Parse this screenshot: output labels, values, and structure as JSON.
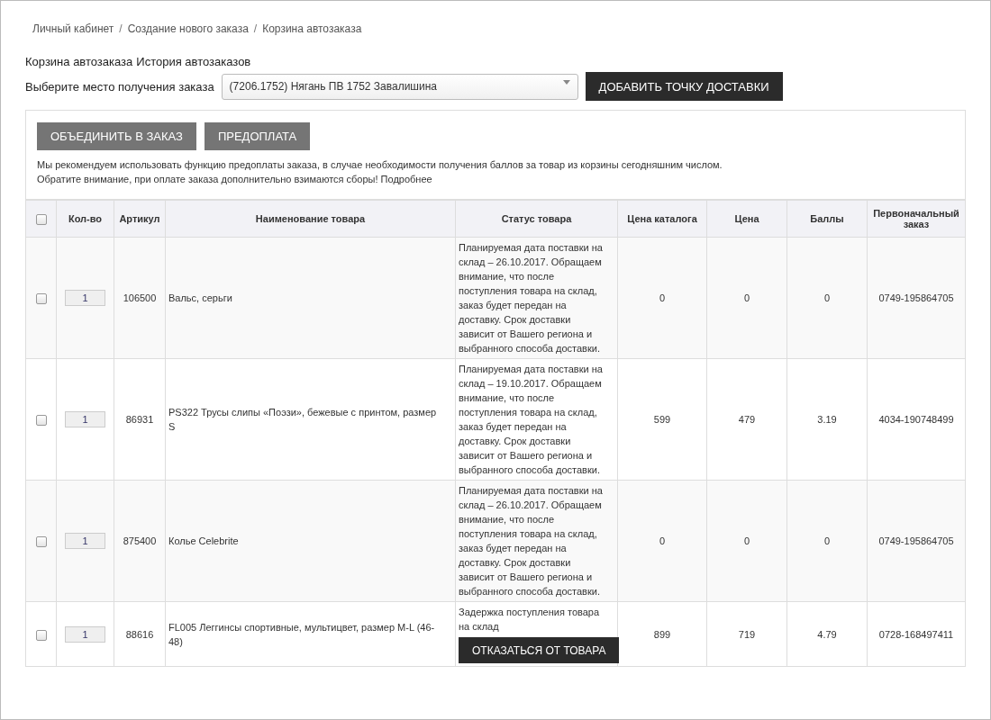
{
  "breadcrumbs": [
    "Личный кабинет",
    "Создание нового заказа",
    "Корзина автозаказа"
  ],
  "separator": "/",
  "tabs": [
    "Корзина автозаказа",
    "История автозаказов"
  ],
  "delivery": {
    "label": "Выберите место получения заказа",
    "value": "(7206.1752) Нягань ПВ 1752 Завалишина",
    "button": "ДОБАВИТЬ ТОЧКУ ДОСТАВКИ"
  },
  "actions": [
    "ОБЪЕДИНИТЬ В ЗАКАЗ",
    "ПРЕДОПЛАТА"
  ],
  "notes": [
    "Мы рекомендуем использовать функцию предоплаты заказа, в случае необходимости получения баллов за товар из корзины сегодняшним числом.",
    "Обратите внимание, при оплате заказа дополнительно взимаются сборы! Подробнее"
  ],
  "table": {
    "select_all_checked": false,
    "columns": [
      "Кол-во",
      "Артикул",
      "Наименование товара",
      "Статус товара",
      "Цена каталога",
      "Цена",
      "Баллы",
      "Первоначальный заказ"
    ],
    "rows": [
      {
        "checked": false,
        "qty": "1",
        "article": "106500",
        "name": "Вальс, серьги",
        "status": "Планируемая дата поставки на склад – 26.10.2017. Обращаем внимание, что после поступления товара на склад, заказ будет передан на доставку. Срок доставки зависит от Вашего региона и выбранного способа доставки.",
        "catalog_price": "0",
        "price": "0",
        "points": "0",
        "original_order": "0749-195864705"
      },
      {
        "checked": false,
        "qty": "1",
        "article": "86931",
        "name": "PS322 Трусы слипы «Поэзи», бежевые с принтом, размер S",
        "status": "Планируемая дата поставки на склад – 19.10.2017. Обращаем внимание, что после поступления товара на склад, заказ будет передан на доставку. Срок доставки зависит от Вашего региона и выбранного способа доставки.",
        "catalog_price": "599",
        "price": "479",
        "points": "3.19",
        "original_order": "4034-190748499"
      },
      {
        "checked": false,
        "qty": "1",
        "article": "875400",
        "name": "Колье Celebrite",
        "status": "Планируемая дата поставки на склад – 26.10.2017. Обращаем внимание, что после поступления товара на склад, заказ будет передан на доставку. Срок доставки зависит от Вашего региона и выбранного способа доставки.",
        "catalog_price": "0",
        "price": "0",
        "points": "0",
        "original_order": "0749-195864705"
      },
      {
        "checked": false,
        "qty": "1",
        "article": "88616",
        "name": "FL005 Леггинсы спортивные, мультицвет, размер M-L (46-48)",
        "status": "Задержка поступления товара на склад",
        "action": "ОТКАЗАТЬСЯ ОТ ТОВАРА",
        "catalog_price": "899",
        "price": "719",
        "points": "4.79",
        "original_order": "0728-168497411"
      }
    ]
  }
}
